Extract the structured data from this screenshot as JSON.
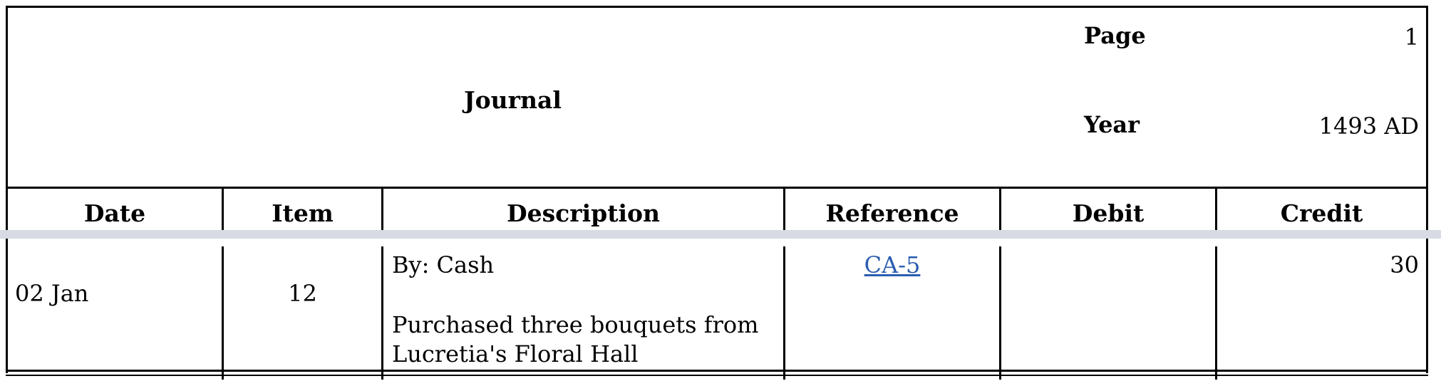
{
  "header": {
    "title": "Journal",
    "page_label": "Page",
    "page_value": "1",
    "year_label": "Year",
    "year_value": "1493 AD"
  },
  "columns": [
    "Date",
    "Item",
    "Description",
    "Reference",
    "Debit",
    "Credit"
  ],
  "rows": [
    {
      "date": "02 Jan",
      "item": "12",
      "description_by": "By: Cash",
      "description_note": "Purchased three bouquets from Lucretia's Floral Hall",
      "reference": "CA-5",
      "debit": "",
      "credit": "30"
    }
  ],
  "colors": {
    "link": "#2a5db0",
    "band": "#d8dbe3"
  }
}
